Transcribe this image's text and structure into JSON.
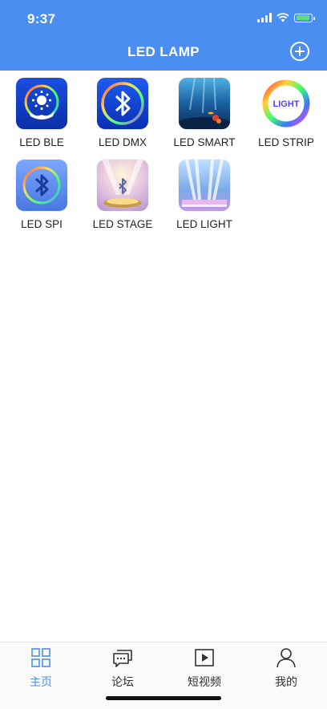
{
  "status_bar": {
    "time": "9:37"
  },
  "nav": {
    "title": "LED LAMP"
  },
  "apps": [
    {
      "label": "LED BLE"
    },
    {
      "label": "LED DMX"
    },
    {
      "label": "LED SMART"
    },
    {
      "label": "LED STRIP",
      "icon_text": "LIGHT"
    },
    {
      "label": "LED SPI"
    },
    {
      "label": "LED STAGE"
    },
    {
      "label": "LED LIGHT"
    }
  ],
  "tabs": [
    {
      "label": "主页",
      "active": true
    },
    {
      "label": "论坛"
    },
    {
      "label": "短视频"
    },
    {
      "label": "我的"
    }
  ],
  "colors": {
    "accent": "#4a8ef2",
    "battery": "#5fe06b"
  }
}
